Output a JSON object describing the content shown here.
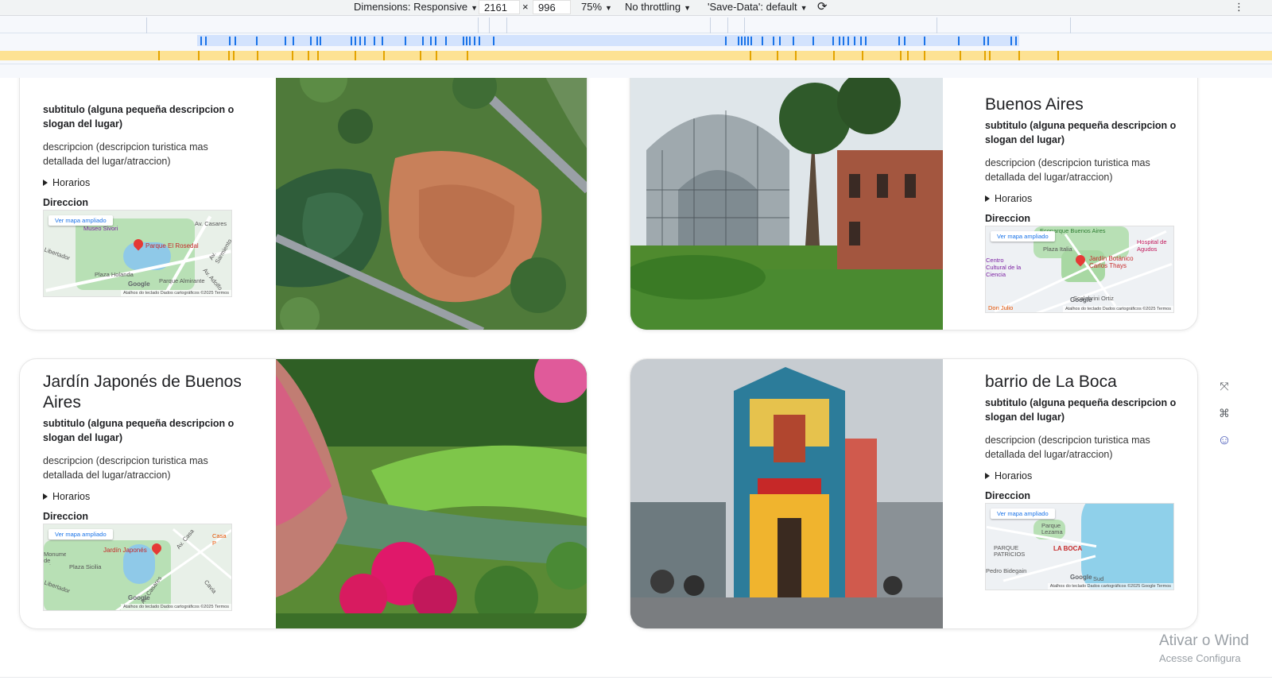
{
  "devtools": {
    "dimensions_label": "Dimensions: Responsive",
    "width_value": "2161",
    "times": "×",
    "height_value": "996",
    "zoom": "75%",
    "throttling": "No throttling",
    "save_data": "'Save-Data': default",
    "more": "⋮"
  },
  "cards": [
    {
      "title": "",
      "subtitle": "subtitulo (alguna pequeña descripcion o slogan del lugar)",
      "description": "descripcion (descripcion turistica mas detallada del lugar/atraccion)",
      "hours_label": "Horarios",
      "direction_label": "Direccion",
      "map": {
        "ampliado": "Ver mapa ampliado",
        "pin_label": "Parque El Rosedal",
        "labels": [
          "Museo Sivori",
          "Av. Casares",
          "Av. Sarmiento",
          "Libertador",
          "Plaza Holanda",
          "Parque Almirante",
          "Av. Adolfo",
          "Google"
        ],
        "footer": "Atalhos do teclado   Dados cartográficos ©2025   Termos"
      }
    },
    {
      "title": "Buenos Aires",
      "subtitle": "subtitulo (alguna pequeña descripcion o slogan del lugar)",
      "description": "descripcion (descripcion turistica mas detallada del lugar/atraccion)",
      "hours_label": "Horarios",
      "direction_label": "Direccion",
      "map": {
        "ampliado": "Ver mapa ampliado",
        "pin_label": "Jardín Botánico Carlos Thays",
        "labels": [
          "Ecoparque Buenos Aires",
          "Plaza Italia",
          "Hospital de Agudos",
          "Centro Cultural de la Ciencia",
          "Scalabrini Ortiz",
          "Don Julio",
          "Google"
        ],
        "footer": "Atalhos do teclado   Dados cartográficos ©2025   Termos"
      }
    },
    {
      "title": "Jardín Japonés de Buenos Aires",
      "subtitle": "subtitulo (alguna pequeña descripcion o slogan del lugar)",
      "description": "descripcion (descripcion turistica mas detallada del lugar/atraccion)",
      "hours_label": "Horarios",
      "direction_label": "Direccion",
      "map": {
        "ampliado": "Ver mapa ampliado",
        "pin_label": "Jardín Japonés",
        "labels": [
          "Av. Casa",
          "Casa P",
          "Monumento de Héroes",
          "Plaza Sicilia",
          "Libertador",
          "Av. Casares",
          "Cavia",
          "Google"
        ],
        "footer": "Atalhos do teclado   Dados cartográficos ©2025   Termos"
      }
    },
    {
      "title": "barrio de La Boca",
      "subtitle": "subtitulo (alguna pequeña descripcion o slogan del lugar)",
      "description": "descripcion (descripcion turistica mas detallada del lugar/atraccion)",
      "hours_label": "Horarios",
      "direction_label": "Direccion",
      "map": {
        "ampliado": "Ver mapa ampliado",
        "pin_label": "LA BOCA",
        "labels": [
          "Parque Lezama",
          "PARQUE PATRICIOS",
          "Pedro Bidegain",
          "Sud",
          "Google"
        ],
        "footer": "Atalhos do teclado   Dados cartográficos ©2025 Google   Termos"
      }
    }
  ],
  "watermark": {
    "line1": "Ativar o Wind",
    "line2": "Acesse Configura"
  }
}
